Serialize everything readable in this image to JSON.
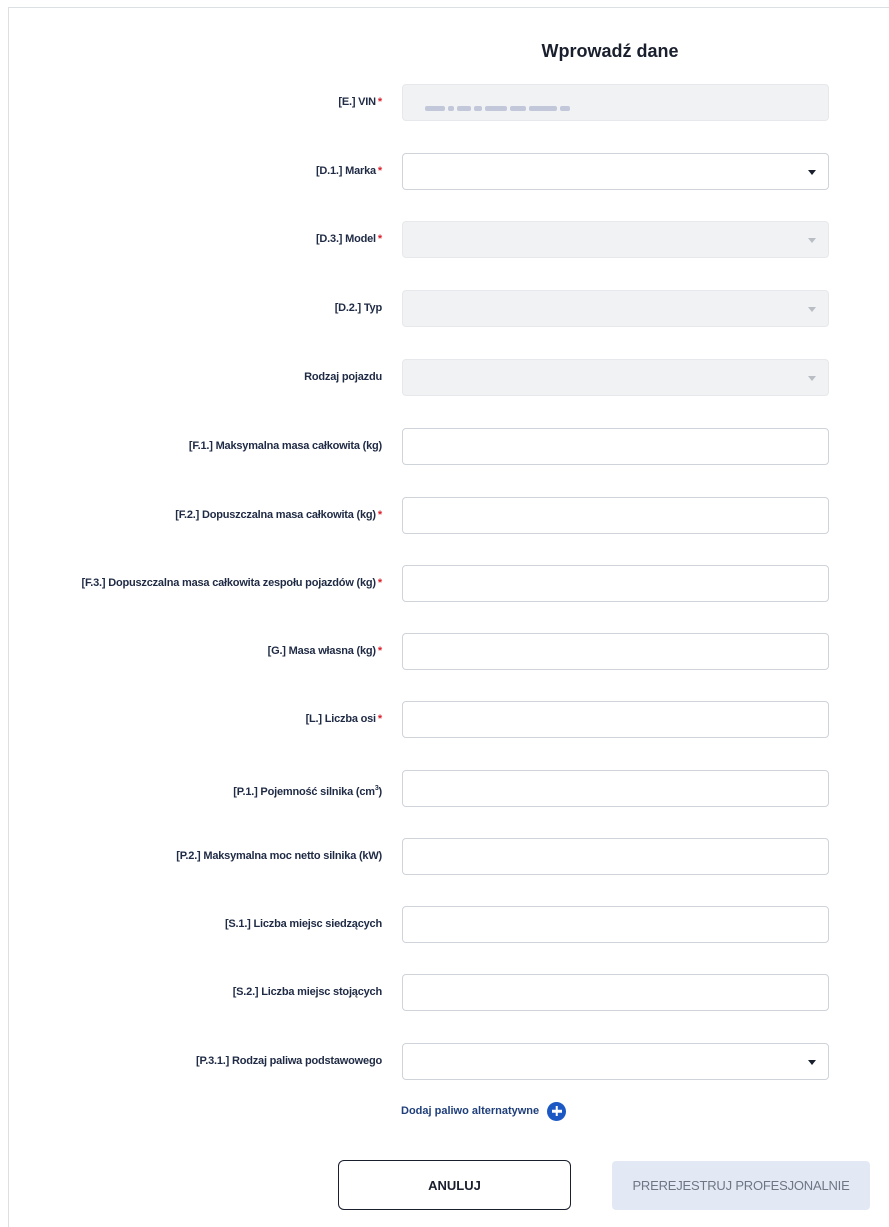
{
  "form": {
    "title": "Wprowadź dane",
    "required_marker": "*",
    "fields": {
      "vin": {
        "label": "[E.] VIN",
        "required": true,
        "disabled": true
      },
      "marka": {
        "label": "[D.1.] Marka",
        "required": true,
        "type": "select"
      },
      "model": {
        "label": "[D.3.] Model",
        "required": true,
        "type": "select",
        "disabled": true
      },
      "typ": {
        "label": "[D.2.] Typ",
        "required": false,
        "type": "select",
        "disabled": true
      },
      "rodzaj_pojazdu": {
        "label": "Rodzaj pojazdu",
        "required": false,
        "type": "select",
        "disabled": true
      },
      "f1": {
        "label": "[F.1.] Maksymalna masa całkowita (kg)",
        "required": false
      },
      "f2": {
        "label": "[F.2.] Dopuszczalna masa całkowita (kg)",
        "required": true
      },
      "f3": {
        "label": "[F.3.] Dopuszczalna masa całkowita zespołu pojazdów (kg)",
        "required": true
      },
      "g": {
        "label": "[G.] Masa własna (kg)",
        "required": true
      },
      "l": {
        "label": "[L.] Liczba osi",
        "required": true
      },
      "p1": {
        "label": "[P.1.] Pojemność silnika (cm",
        "label_sup": "3",
        "label_suffix": ")",
        "required": false
      },
      "p2": {
        "label": "[P.2.] Maksymalna moc netto silnika (kW)",
        "required": false
      },
      "s1": {
        "label": "[S.1.] Liczba miejsc siedzących",
        "required": false
      },
      "s2": {
        "label": "[S.2.] Liczba miejsc stojących",
        "required": false
      },
      "p31": {
        "label": "[P.3.1.] Rodzaj paliwa podstawowego",
        "required": false,
        "type": "select"
      }
    },
    "add_alt_fuel_label": "Dodaj paliwo alternatywne",
    "cancel_label": "ANULUJ",
    "submit_label": "PREREJESTRUJ PROFESJONALNIE"
  },
  "colors": {
    "required": "#d91f2b",
    "accent": "#1c58c4",
    "link": "#1f3f7a",
    "disabled_bg": "#f1f2f4",
    "submit_disabled_bg": "#e3e9f4"
  },
  "icons": {
    "dropdown": "chevron-down-icon",
    "add": "plus-circle-icon"
  }
}
